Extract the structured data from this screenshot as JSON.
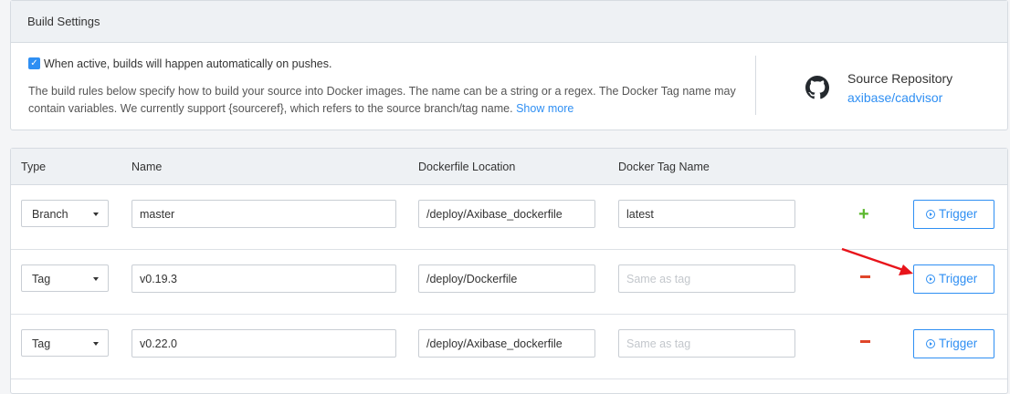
{
  "header": {
    "title": "Build Settings"
  },
  "autobuild": {
    "checked": true,
    "label": "When active, builds will happen automatically on pushes.",
    "description": "The build rules below specify how to build your source into Docker images. The name can be a string or a regex. The Docker Tag name may contain variables. We currently support {sourceref}, which refers to the source branch/tag name.",
    "show_more": "Show more"
  },
  "source": {
    "label": "Source Repository",
    "repo": "axibase/cadvisor",
    "icon": "github-icon"
  },
  "table": {
    "columns": [
      "Type",
      "Name",
      "Dockerfile Location",
      "Docker Tag Name"
    ],
    "rows": [
      {
        "type": "Branch",
        "name": "master",
        "dockerfile": "/deploy/Axibase_dockerfile",
        "tag": "latest",
        "tag_placeholder": "",
        "action": "add",
        "trigger": "Trigger"
      },
      {
        "type": "Tag",
        "name": "v0.19.3",
        "dockerfile": "/deploy/Dockerfile",
        "tag": "",
        "tag_placeholder": "Same as tag",
        "action": "remove",
        "trigger": "Trigger"
      },
      {
        "type": "Tag",
        "name": "v0.22.0",
        "dockerfile": "/deploy/Axibase_dockerfile",
        "tag": "",
        "tag_placeholder": "Same as tag",
        "action": "remove",
        "trigger": "Trigger"
      }
    ]
  },
  "colors": {
    "accent": "#2f8ff3",
    "add": "#5cb82f",
    "remove": "#e0462a",
    "annotation_arrow": "#e8141b"
  }
}
